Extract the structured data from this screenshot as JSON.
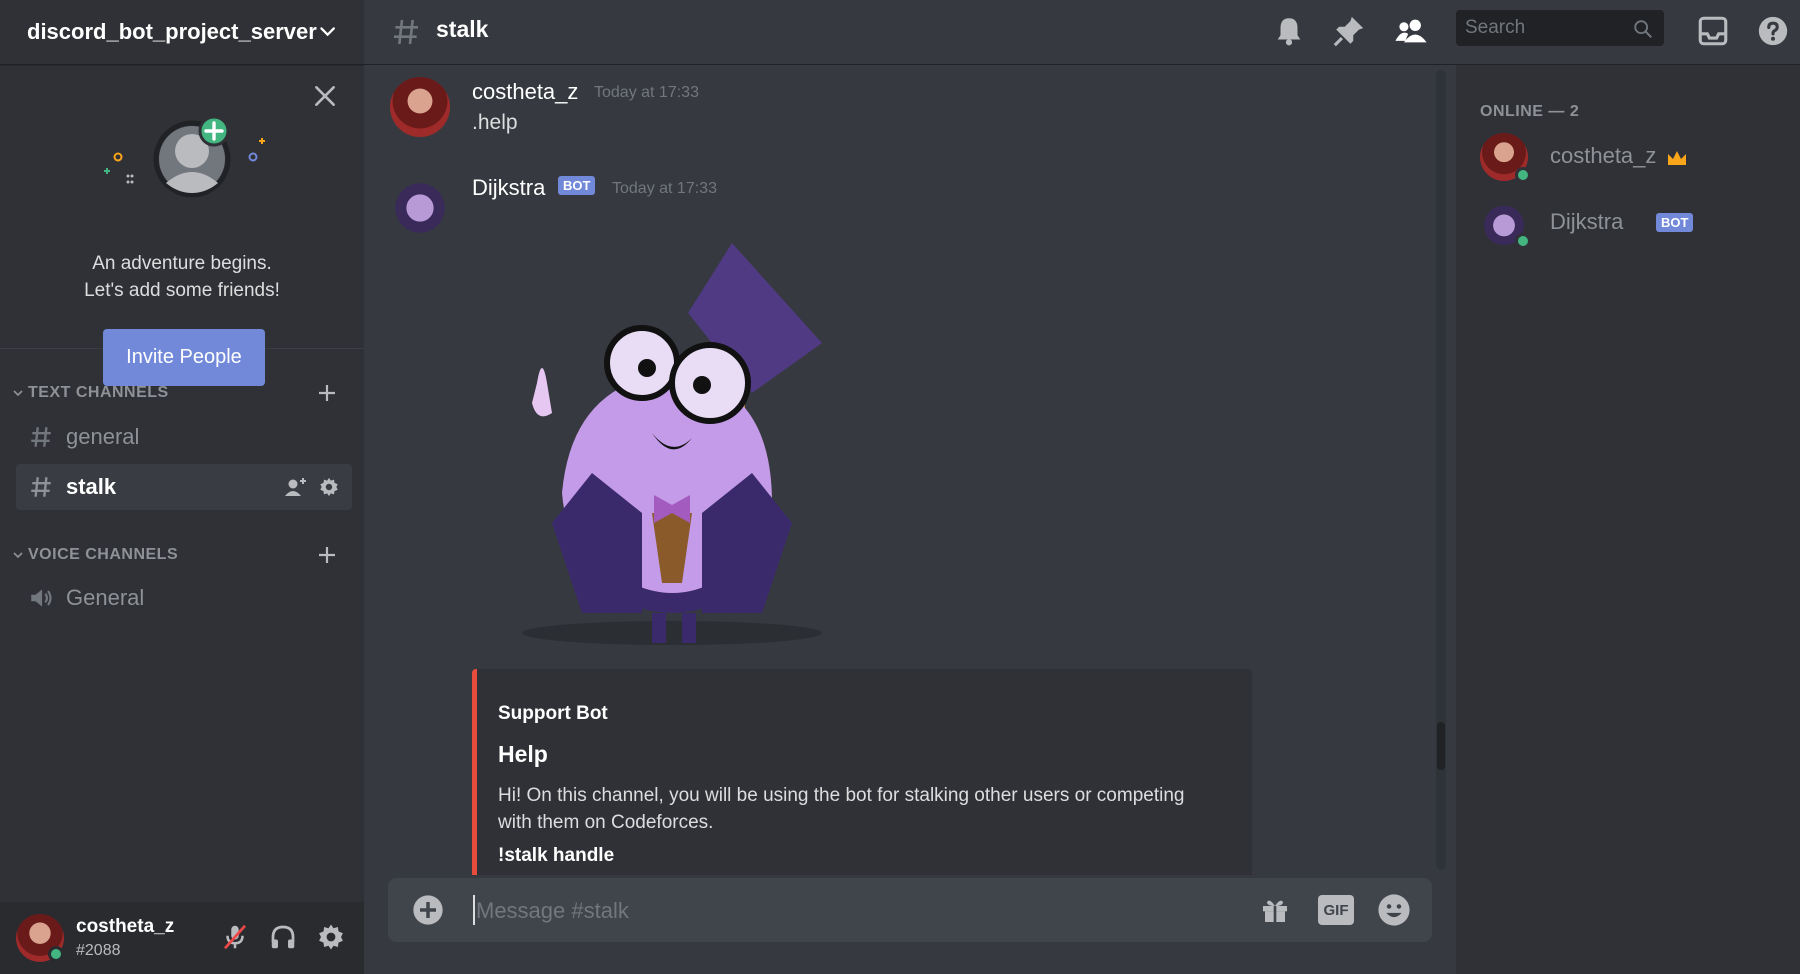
{
  "server": {
    "name": "discord_bot_project_server"
  },
  "welcome": {
    "line1": "An adventure begins.",
    "line2": "Let's add some friends!",
    "invite_label": "Invite People"
  },
  "categories": {
    "text": "TEXT CHANNELS",
    "voice": "VOICE CHANNELS"
  },
  "channels": {
    "text": [
      {
        "name": "general",
        "active": false
      },
      {
        "name": "stalk",
        "active": true
      }
    ],
    "voice": [
      {
        "name": "General"
      }
    ]
  },
  "current_user": {
    "name": "costheta_z",
    "discriminator": "#2088"
  },
  "header": {
    "channel": "stalk",
    "search_placeholder": "Search"
  },
  "messages": [
    {
      "author": "costheta_z",
      "time": "Today at 17:33",
      "text": ".help",
      "bot": false
    },
    {
      "author": "Dijkstra",
      "time": "Today at 17:33",
      "bot": true,
      "bot_label": "BOT"
    }
  ],
  "embed": {
    "author": "Support Bot",
    "title": "Help",
    "description": "Hi! On this channel, you will be using the bot for stalking other users or competing with them on Codeforces.",
    "field": "!stalk handle",
    "color": "#e74c3c"
  },
  "composer": {
    "placeholder": "Message #stalk",
    "gif_label": "GIF"
  },
  "members": {
    "heading": "ONLINE — 2",
    "list": [
      {
        "name": "costheta_z",
        "owner": true
      },
      {
        "name": "Dijkstra",
        "bot_label": "BOT"
      }
    ]
  },
  "colors": {
    "accent": "#7289da",
    "online": "#43b581",
    "owner_crown": "#faa61a"
  }
}
